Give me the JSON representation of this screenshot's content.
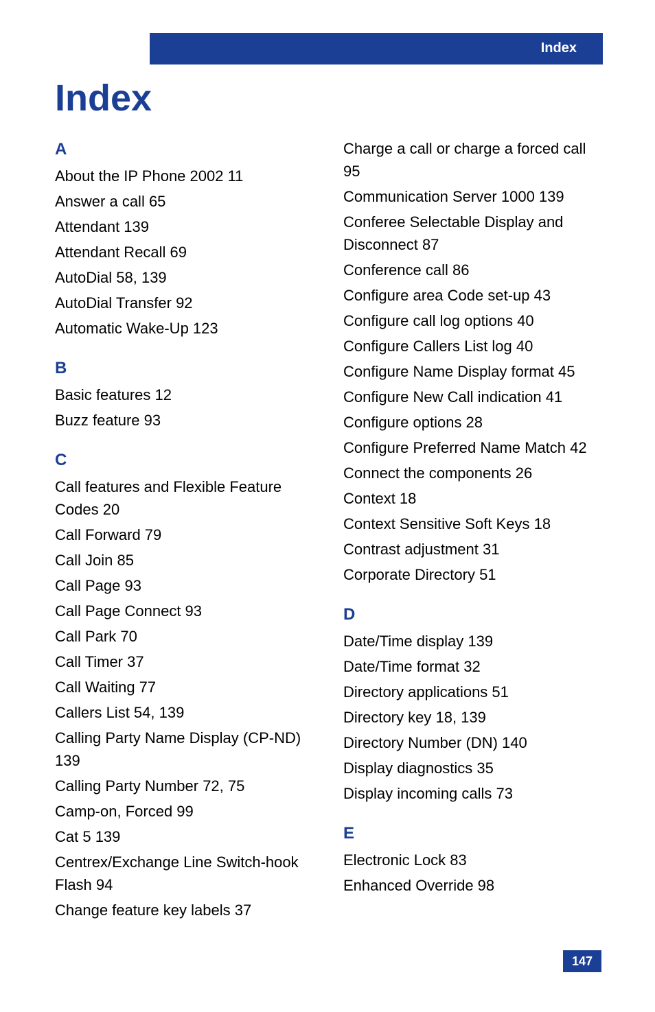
{
  "header": {
    "tab_label": "Index"
  },
  "title": "Index",
  "page_number": "147",
  "col1": {
    "A_letter": "A",
    "A": [
      "About the IP Phone 2002 11",
      "Answer a call 65",
      "Attendant 139",
      "Attendant Recall 69",
      "AutoDial 58, 139",
      "AutoDial Transfer 92",
      "Automatic Wake-Up 123"
    ],
    "B_letter": "B",
    "B": [
      "Basic features 12",
      "Buzz feature 93"
    ],
    "C_letter": "C",
    "C": [
      "Call features and Flexible Feature Codes 20",
      "Call Forward 79",
      "Call Join 85",
      "Call Page 93",
      "Call Page Connect 93",
      "Call Park 70",
      "Call Timer 37",
      "Call Waiting 77",
      "Callers List 54, 139",
      "Calling Party Name Display (CP-ND) 139",
      "Calling Party Number 72, 75",
      "Camp-on, Forced 99",
      "Cat 5 139",
      "Centrex/Exchange Line Switch-hook Flash 94",
      "Change feature key labels 37"
    ]
  },
  "col2": {
    "C_cont": [
      "Charge a call or charge a forced call 95",
      "Communication Server 1000 139",
      "Conferee Selectable Display and Disconnect 87",
      "Conference call 86",
      "Configure area Code set-up 43",
      "Configure call log options 40",
      "Configure Callers List log 40",
      "Configure Name Display format 45",
      "Configure New Call indication 41",
      "Configure options 28",
      "Configure Preferred Name Match 42",
      "Connect the components 26",
      "Context 18",
      "Context Sensitive Soft Keys 18",
      "Contrast adjustment 31",
      "Corporate Directory 51"
    ],
    "D_letter": "D",
    "D": [
      "Date/Time display 139",
      "Date/Time format 32",
      "Directory applications 51",
      "Directory key 18, 139",
      "Directory Number (DN) 140",
      "Display diagnostics 35",
      "Display incoming calls 73"
    ],
    "E_letter": "E",
    "E": [
      "Electronic Lock 83",
      "Enhanced Override 98"
    ]
  }
}
